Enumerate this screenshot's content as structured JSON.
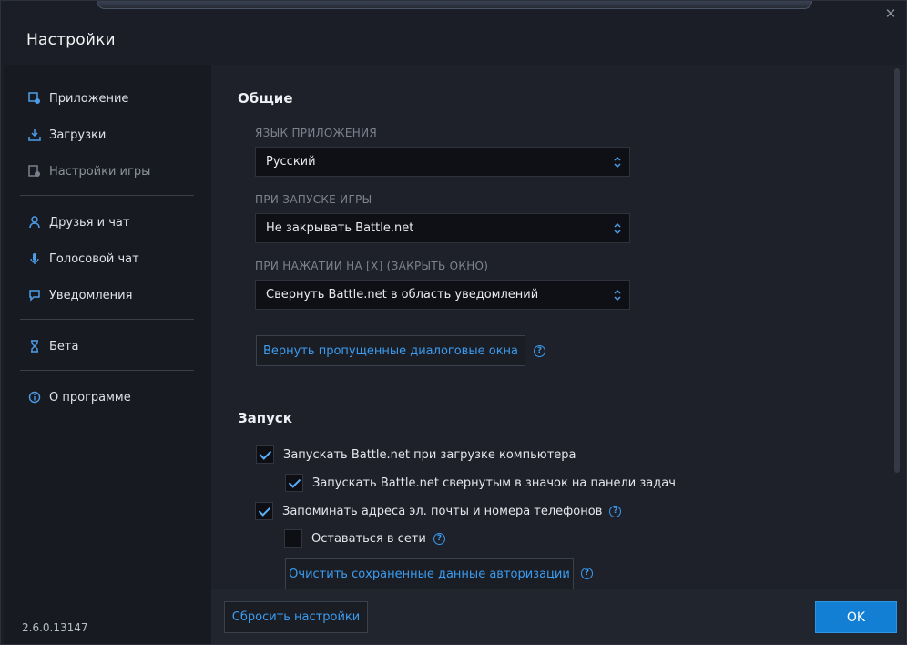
{
  "window": {
    "title": "Настройки",
    "close_glyph": "✕"
  },
  "sidebar": {
    "items": [
      {
        "label": "Приложение",
        "icon": "app-settings-icon"
      },
      {
        "label": "Загрузки",
        "icon": "download-icon"
      },
      {
        "label": "Настройки игры",
        "icon": "game-settings-icon",
        "disabled": true
      },
      {
        "label": "Друзья и чат",
        "icon": "friends-icon"
      },
      {
        "label": "Голосовой чат",
        "icon": "microphone-icon"
      },
      {
        "label": "Уведомления",
        "icon": "notification-icon"
      },
      {
        "label": "Бета",
        "icon": "flask-icon"
      },
      {
        "label": "О программе",
        "icon": "info-icon"
      }
    ],
    "version": "2.6.0.13147"
  },
  "general": {
    "title": "Общие",
    "language": {
      "label": "ЯЗЫК ПРИЛОЖЕНИЯ",
      "value": "Русский"
    },
    "on_game_launch": {
      "label": "ПРИ ЗАПУСКЕ ИГРЫ",
      "value": "Не закрывать Battle.net"
    },
    "on_close": {
      "label": "ПРИ НАЖАТИИ НА [X] (ЗАКРЫТЬ ОКНО)",
      "value": "Свернуть Battle.net в область уведомлений"
    },
    "restore_dialogs_button": "Вернуть пропущенные диалоговые окна"
  },
  "launch": {
    "title": "Запуск",
    "options": [
      {
        "label": "Запускать Battle.net при загрузке компьютера",
        "checked": true
      },
      {
        "label": "Запускать Battle.net свернутым в значок на панели задач",
        "checked": true
      },
      {
        "label": "Запоминать адреса эл. почты и номера телефонов",
        "checked": true
      },
      {
        "label": "Оставаться в сети",
        "checked": false
      }
    ],
    "clear_auth_button": "Очистить сохраненные данные авторизации"
  },
  "footer": {
    "reset_button": "Сбросить настройки",
    "ok_button": "OK"
  },
  "colors": {
    "accent": "#3c9cf0",
    "ok_button_bg": "#127fd4",
    "background": "#1b1e26"
  }
}
